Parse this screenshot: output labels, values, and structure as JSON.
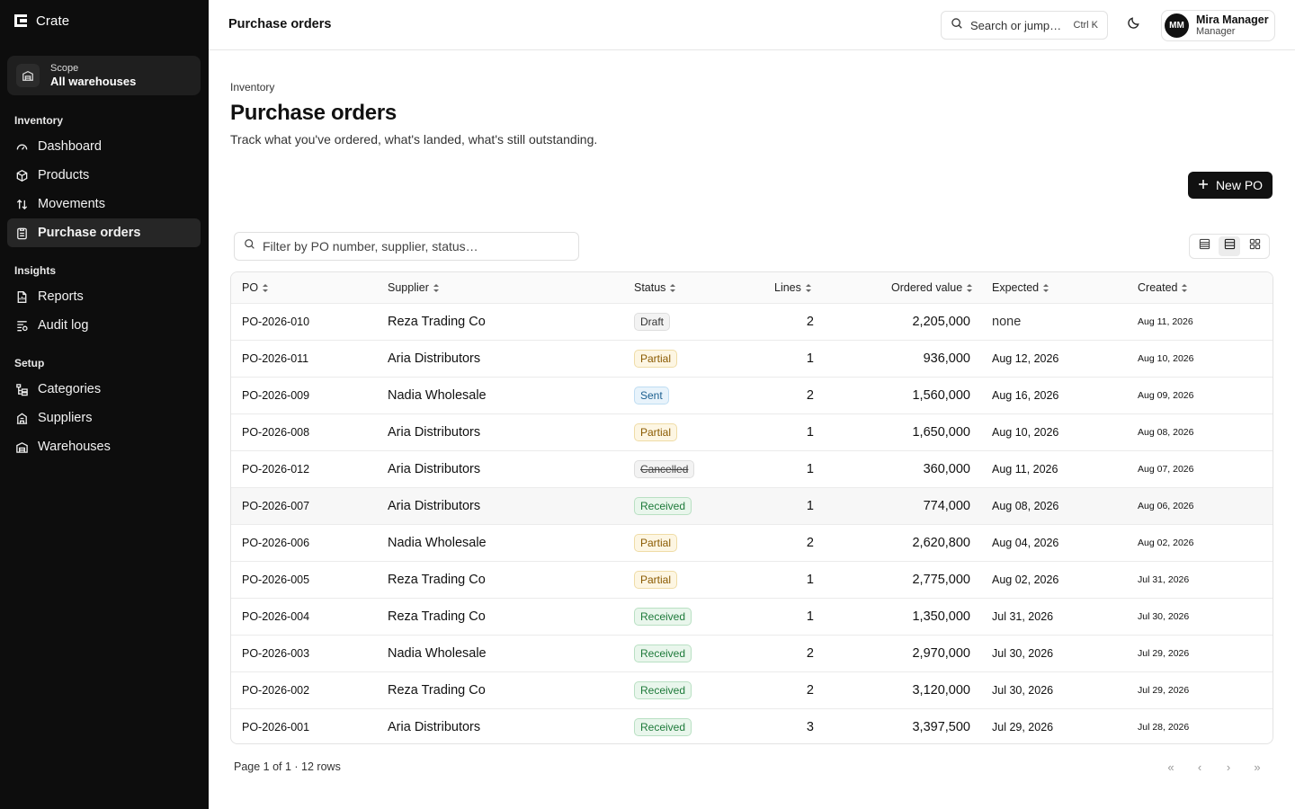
{
  "app": {
    "name": "Crate"
  },
  "scope": {
    "label": "Scope",
    "value": "All warehouses"
  },
  "sidebar": {
    "groups": [
      {
        "label": "Inventory"
      },
      {
        "label": "Insights"
      },
      {
        "label": "Setup"
      }
    ],
    "items": [
      {
        "label": "Dashboard",
        "icon": "gauge-icon"
      },
      {
        "label": "Products",
        "icon": "package-icon"
      },
      {
        "label": "Movements",
        "icon": "arrows-up-down-icon"
      },
      {
        "label": "Purchase orders",
        "icon": "clipboard-list-icon",
        "active": true
      },
      {
        "label": "Reports",
        "icon": "file-report-icon"
      },
      {
        "label": "Audit log",
        "icon": "audit-log-icon"
      },
      {
        "label": "Categories",
        "icon": "category-tree-icon"
      },
      {
        "label": "Suppliers",
        "icon": "building-icon"
      },
      {
        "label": "Warehouses",
        "icon": "warehouse-icon"
      }
    ]
  },
  "topbar": {
    "title": "Purchase orders",
    "search_placeholder": "Search or jump…",
    "search_shortcut": "Ctrl K",
    "user": {
      "initials": "MM",
      "name": "Mira Manager",
      "role": "Manager"
    }
  },
  "page": {
    "eyebrow": "Inventory",
    "title": "Purchase orders",
    "subtitle": "Track what you've ordered, what's landed, what's still outstanding.",
    "new_button": "New PO",
    "filter_placeholder": "Filter by PO number, supplier, status…"
  },
  "table": {
    "columns": [
      "PO",
      "Supplier",
      "Status",
      "Lines",
      "Ordered value",
      "Expected",
      "Created"
    ],
    "rows": [
      {
        "po": "PO-2026-010",
        "supplier": "Reza Trading Co",
        "status": "Draft",
        "status_key": "draft",
        "lines": "2",
        "value": "2,205,000",
        "expected": "none",
        "created": "Aug 11, 2026"
      },
      {
        "po": "PO-2026-011",
        "supplier": "Aria Distributors",
        "status": "Partial",
        "status_key": "partial",
        "lines": "1",
        "value": "936,000",
        "expected": "Aug 12, 2026",
        "created": "Aug 10, 2026"
      },
      {
        "po": "PO-2026-009",
        "supplier": "Nadia Wholesale",
        "status": "Sent",
        "status_key": "sent",
        "lines": "2",
        "value": "1,560,000",
        "expected": "Aug 16, 2026",
        "created": "Aug 09, 2026"
      },
      {
        "po": "PO-2026-008",
        "supplier": "Aria Distributors",
        "status": "Partial",
        "status_key": "partial",
        "lines": "1",
        "value": "1,650,000",
        "expected": "Aug 10, 2026",
        "created": "Aug 08, 2026"
      },
      {
        "po": "PO-2026-012",
        "supplier": "Aria Distributors",
        "status": "Cancelled",
        "status_key": "cancelled",
        "lines": "1",
        "value": "360,000",
        "expected": "Aug 11, 2026",
        "created": "Aug 07, 2026"
      },
      {
        "po": "PO-2026-007",
        "supplier": "Aria Distributors",
        "status": "Received",
        "status_key": "received",
        "lines": "1",
        "value": "774,000",
        "expected": "Aug 08, 2026",
        "created": "Aug 06, 2026"
      },
      {
        "po": "PO-2026-006",
        "supplier": "Nadia Wholesale",
        "status": "Partial",
        "status_key": "partial",
        "lines": "2",
        "value": "2,620,800",
        "expected": "Aug 04, 2026",
        "created": "Aug 02, 2026"
      },
      {
        "po": "PO-2026-005",
        "supplier": "Reza Trading Co",
        "status": "Partial",
        "status_key": "partial",
        "lines": "1",
        "value": "2,775,000",
        "expected": "Aug 02, 2026",
        "created": "Jul 31, 2026"
      },
      {
        "po": "PO-2026-004",
        "supplier": "Reza Trading Co",
        "status": "Received",
        "status_key": "received",
        "lines": "1",
        "value": "1,350,000",
        "expected": "Jul 31, 2026",
        "created": "Jul 30, 2026"
      },
      {
        "po": "PO-2026-003",
        "supplier": "Nadia Wholesale",
        "status": "Received",
        "status_key": "received",
        "lines": "2",
        "value": "2,970,000",
        "expected": "Jul 30, 2026",
        "created": "Jul 29, 2026"
      },
      {
        "po": "PO-2026-002",
        "supplier": "Reza Trading Co",
        "status": "Received",
        "status_key": "received",
        "lines": "2",
        "value": "3,120,000",
        "expected": "Jul 30, 2026",
        "created": "Jul 29, 2026"
      },
      {
        "po": "PO-2026-001",
        "supplier": "Aria Distributors",
        "status": "Received",
        "status_key": "received",
        "lines": "3",
        "value": "3,397,500",
        "expected": "Jul 29, 2026",
        "created": "Jul 28, 2026"
      }
    ]
  },
  "pagination": {
    "info": "Page 1 of 1 · 12 rows"
  },
  "colors": {
    "sidebar_bg": "#0d0d0d",
    "primary_button": "#111111",
    "received": "#1e7a3a",
    "partial": "#8a5a00",
    "sent": "#1b5f8f"
  }
}
